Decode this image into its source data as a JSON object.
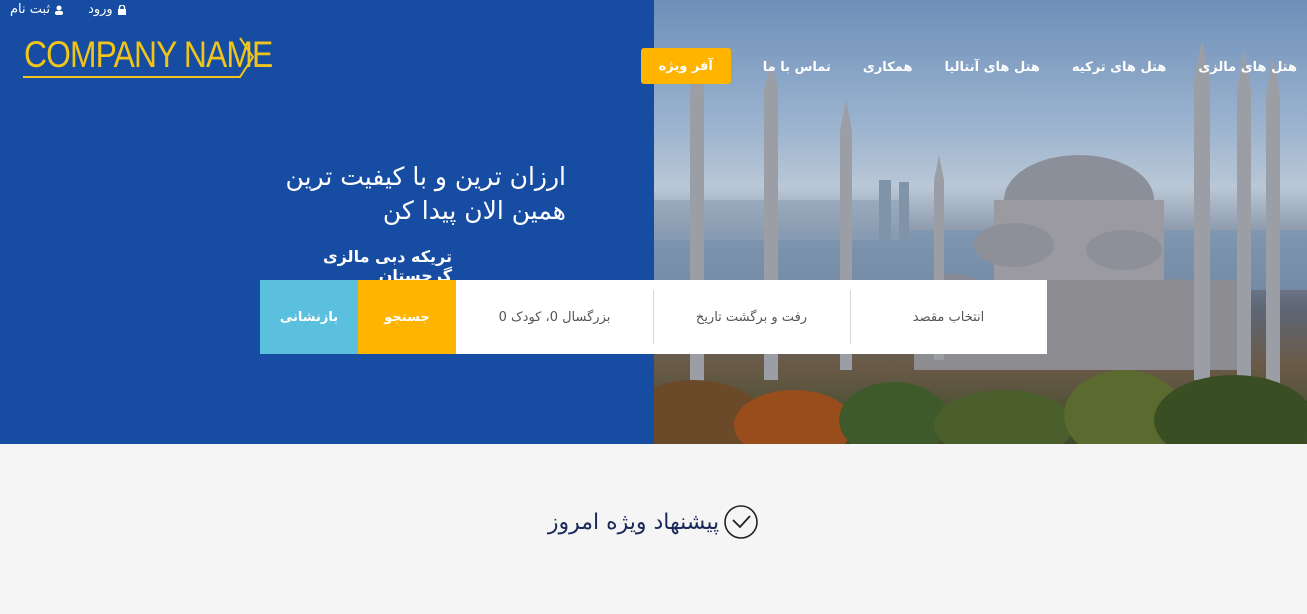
{
  "auth": {
    "login": "ورود",
    "register": "ثبت نام"
  },
  "logo": {
    "text": "COMPANY NAME"
  },
  "nav": {
    "items": [
      "هتل های مالزی",
      "هتل های ترکیه",
      "هتل های آنتالیا",
      "همکاری",
      "تماس با ما"
    ],
    "offer": "آفر ویژه"
  },
  "hero": {
    "headline_line1": "ارزان ترین و با کیفیت ترین",
    "headline_line2": "همین الان پیدا کن",
    "subline": "تریکه دبی مالزی گرجستان"
  },
  "search": {
    "destination": "انتخاب مقصد",
    "dates": "رفت و برگشت تاریخ",
    "passengers": "بزرگسال 0، کودک 0",
    "search_label": "جستجو",
    "reset_label": "بازنشانی"
  },
  "section": {
    "title": "پیشنهاد ویژه امروز"
  },
  "colors": {
    "primary": "#164da3",
    "accent": "#ffb400",
    "reset": "#5bc0de",
    "logo": "#f0c419"
  }
}
